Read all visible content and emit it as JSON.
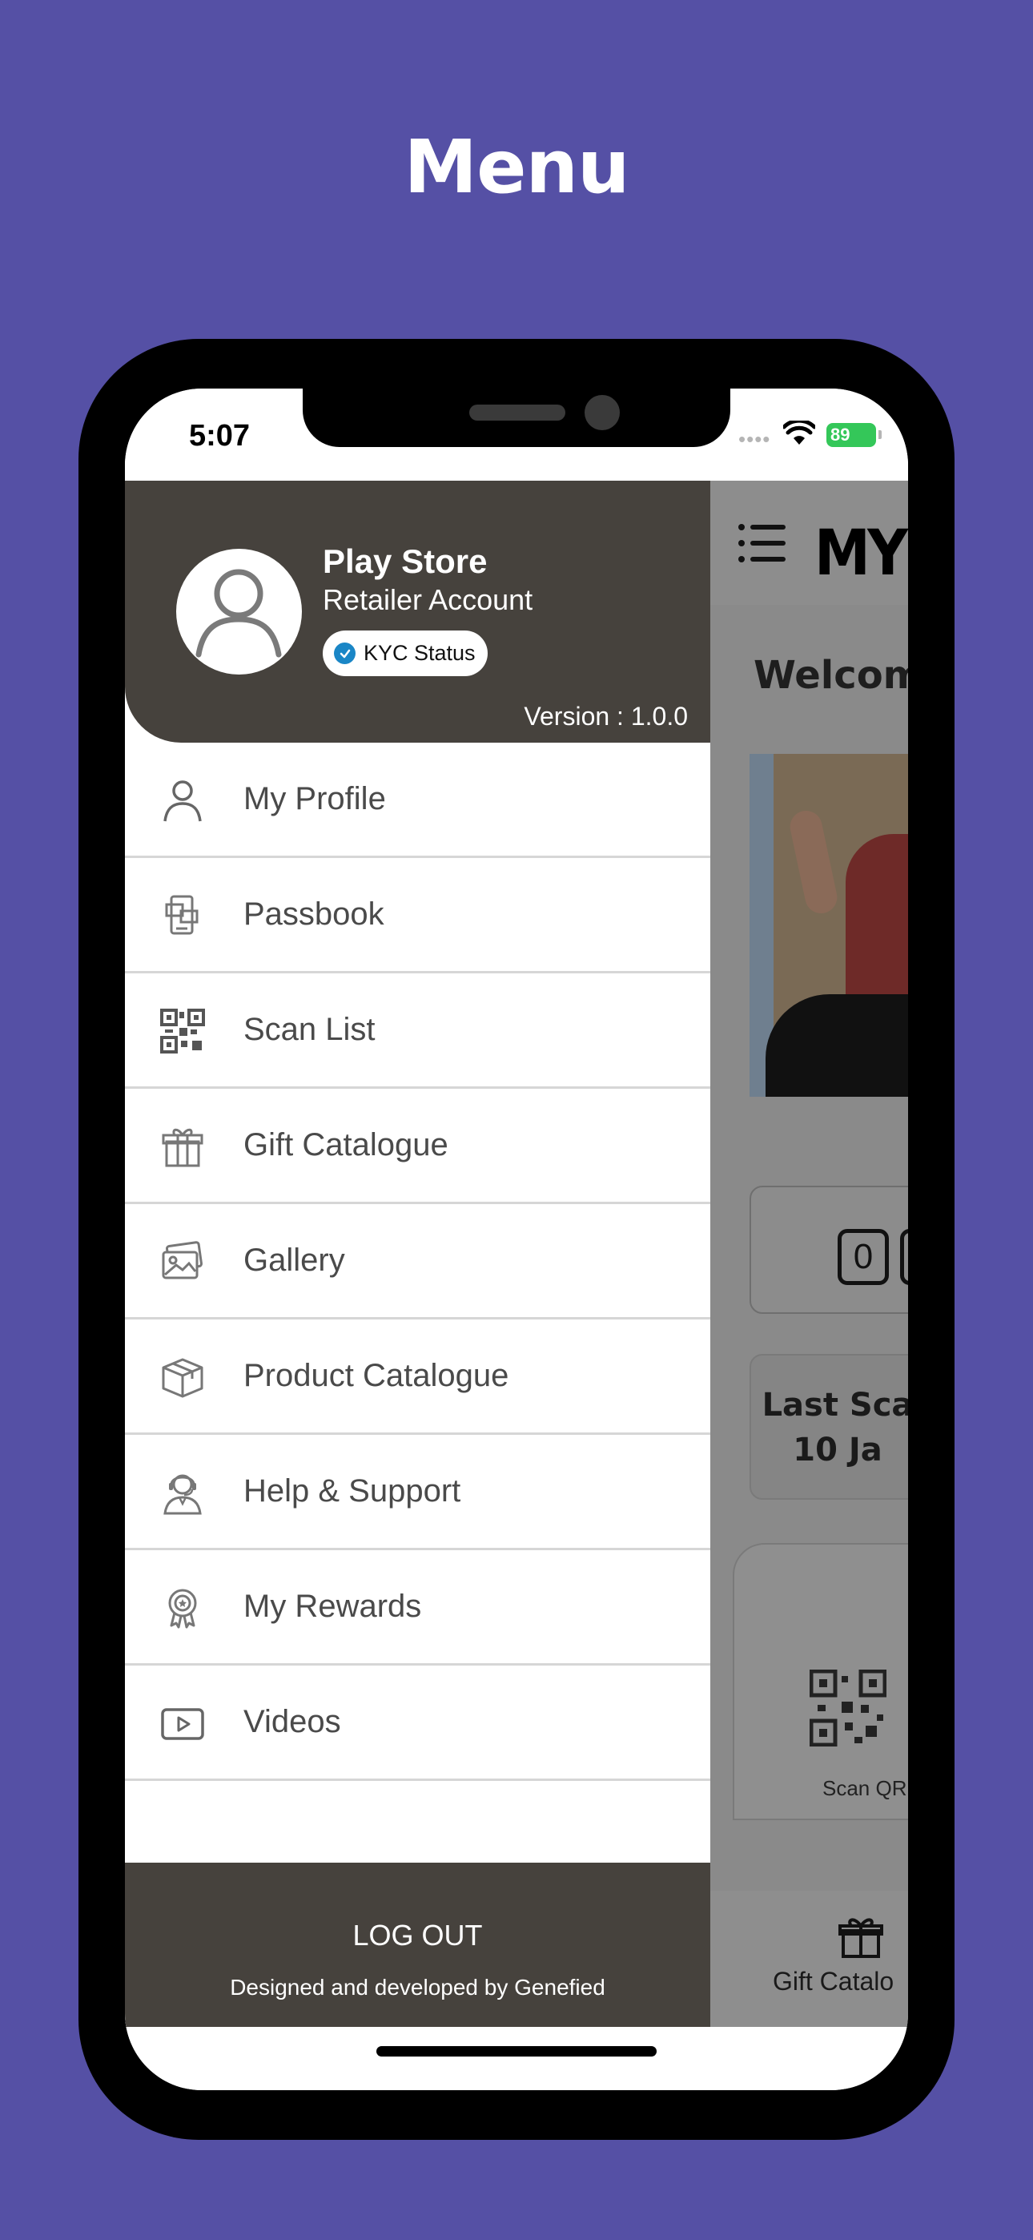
{
  "headline": "Menu",
  "status_bar": {
    "time": "5:07",
    "battery": "89"
  },
  "background_app": {
    "logo": "MY",
    "welcome": "Welcom",
    "counter_digit": "0",
    "last_scan_line1": "Last Sca",
    "last_scan_line2": "10 Ja",
    "scan_label": "Scan QR",
    "bottom_tab_label": "Gift Catalo"
  },
  "drawer": {
    "profile": {
      "name": "Play Store",
      "role": "Retailer Account",
      "kyc_label": "KYC Status",
      "version": "Version : 1.0.0"
    },
    "menu_items": [
      {
        "label": "My Profile",
        "icon": "user-icon"
      },
      {
        "label": "Passbook",
        "icon": "passbook-icon"
      },
      {
        "label": "Scan List",
        "icon": "qr-code-icon"
      },
      {
        "label": "Gift Catalogue",
        "icon": "gift-icon"
      },
      {
        "label": "Gallery",
        "icon": "gallery-icon"
      },
      {
        "label": "Product Catalogue",
        "icon": "box-icon"
      },
      {
        "label": "Help & Support",
        "icon": "support-agent-icon"
      },
      {
        "label": "My Rewards",
        "icon": "reward-badge-icon"
      },
      {
        "label": "Videos",
        "icon": "video-play-icon"
      }
    ],
    "footer": {
      "logout_label": "LOG OUT",
      "credit": "Designed and developed by Genefied"
    }
  },
  "colors": {
    "page_background": "#5550a5",
    "drawer_header": "#46423d",
    "kyc_check": "#1a86c6",
    "battery": "#34c759"
  }
}
